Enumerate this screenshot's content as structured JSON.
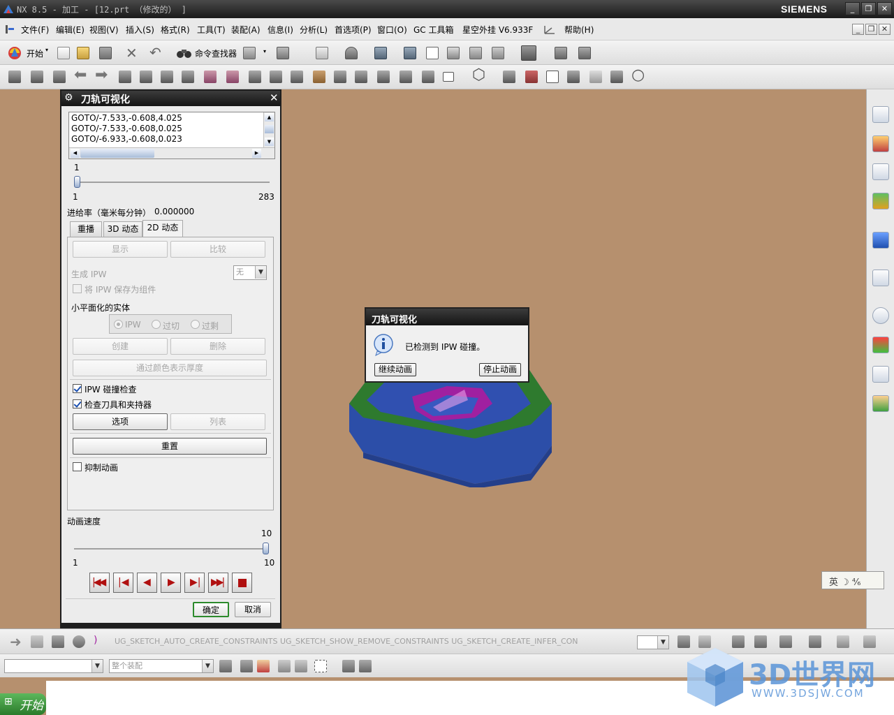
{
  "window": {
    "title": "NX 8.5 - 加工 - [12.prt （修改的） ]",
    "brand": "SIEMENS"
  },
  "menubar": {
    "items": [
      "文件(F)",
      "编辑(E)",
      "视图(V)",
      "插入(S)",
      "格式(R)",
      "工具(T)",
      "装配(A)",
      "信息(I)",
      "分析(L)",
      "首选项(P)",
      "窗口(O)",
      "GC 工具箱",
      "星空外挂 V6.933F",
      "帮助(H)"
    ]
  },
  "toolbar": {
    "start_label": "开始",
    "command_finder": "命令查找器"
  },
  "dialog": {
    "title": "刀轨可视化",
    "list_lines": [
      "GOTO/-7.533,-0.608,4.025",
      "GOTO/-7.533,-0.608,0.025",
      "GOTO/-6.933,-0.608,0.023"
    ],
    "slider_current": "1",
    "slider_min": "1",
    "slider_max": "283",
    "feed_label": "进给率（毫米每分钟）",
    "feed_value": "0.000000",
    "tabs": [
      "重播",
      "3D 动态",
      "2D 动态"
    ],
    "display_btn": "显示",
    "compare_btn": "比较",
    "gen_ipw_label": "生成 IPW",
    "gen_ipw_value": "无",
    "save_ipw_label": "将 IPW 保存为组件",
    "facet_label": "小平面化的实体",
    "radio_ipw": "IPW",
    "radio_overcut": "过切",
    "radio_excess": "过剩",
    "create_btn": "创建",
    "delete_btn": "删除",
    "thickness_btn": "通过颜色表示厚度",
    "ipw_check_label": "IPW 碰撞检查",
    "tool_check_label": "检查刀具和夹持器",
    "options_btn": "选项",
    "list_btn": "列表",
    "reset_btn": "重置",
    "suppress_label": "抑制动画",
    "speed_label": "动画速度",
    "speed_current": "10",
    "speed_min": "1",
    "speed_max": "10",
    "ok_btn": "确定",
    "cancel_btn": "取消"
  },
  "message": {
    "title": "刀轨可视化",
    "text": "已检测到 IPW 碰撞。",
    "continue_btn": "继续动画",
    "stop_btn": "停止动画"
  },
  "bottom": {
    "sketch_cmds": "UG_SKETCH_AUTO_CREATE_CONSTRAINTS  UG_SKETCH_SHOW_REMOVE_CONSTRAINTS  UG_SKETCH_CREATE_INFER_CON",
    "assembly_combo": "整个装配",
    "start_btn": "开始"
  },
  "ime": {
    "text": "英 ☽ ⁴⁄₆"
  },
  "watermark": {
    "title": "3D世界网",
    "url": "WWW.3DSJW.COM"
  },
  "colors": {
    "viewport_bg": "#b6906e",
    "part_blue": "#2c4ea8",
    "part_green": "#2e7a2e",
    "part_magenta": "#a020a0"
  }
}
